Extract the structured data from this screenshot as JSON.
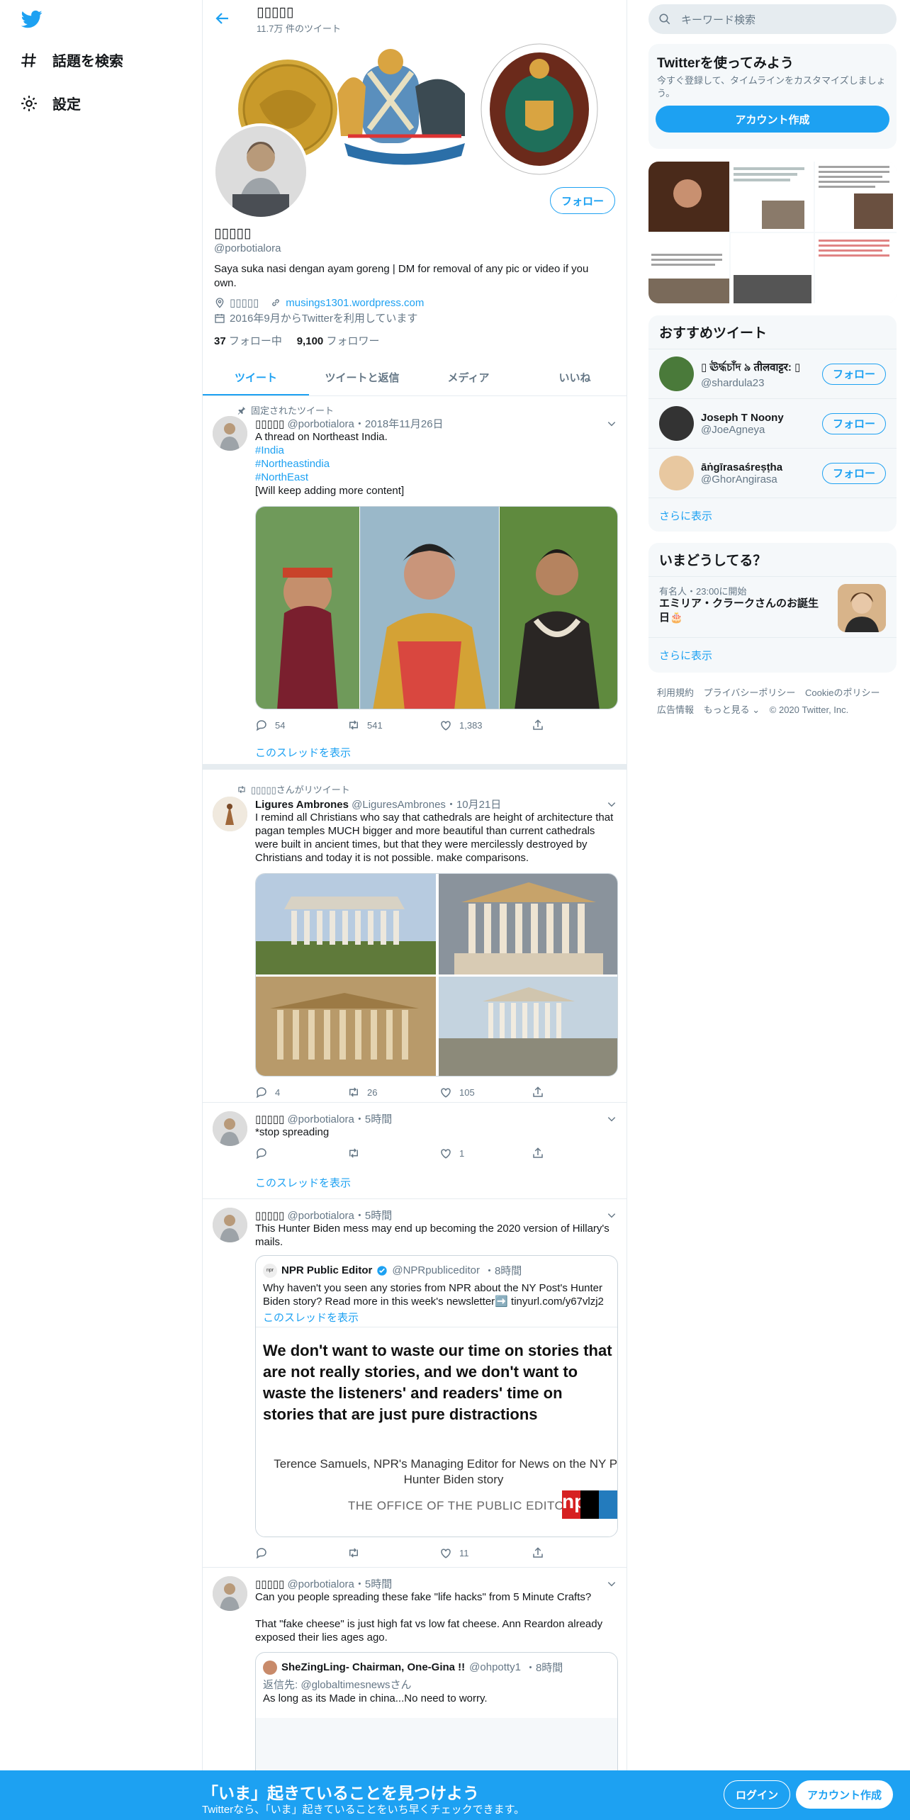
{
  "profile": {
    "display_name": "▯▯▯▯▯",
    "tweet_count": "11.7万 件のツイート",
    "handle": "@porbotialora",
    "bio": "Saya suka nasi dengan ayam goreng | DM for removal of any pic or video if you own.",
    "location": "▯▯▯▯▯",
    "website": "musings1301.wordpress.com",
    "joined": "2016年9月からTwitterを利用しています",
    "following_count": "37",
    "following_label": "フォロー中",
    "followers_count": "9,100",
    "followers_label": "フォロワー",
    "follow_label": "フォロー"
  },
  "nav": {
    "explore_label": "話題を検索",
    "settings_label": "設定"
  },
  "tabs": [
    "ツイート",
    "ツイートと返信",
    "メディア",
    "いいね"
  ],
  "tweets": [
    {
      "context": "固定されたツイート",
      "name": "▯▯▯▯▯",
      "handle": "@porbotialora",
      "time": "・2018年11月26日",
      "text": "A thread on Northeast India.",
      "hashtags": [
        "#India",
        "#Northeastindia",
        "#NorthEast"
      ],
      "extra": "[Will keep adding more content]",
      "replies": "54",
      "retweets": "541",
      "likes": "1,383",
      "thread_label": "このスレッドを表示"
    },
    {
      "context": "▯▯▯▯▯さんがリツイート",
      "name": "Ligures Ambrones",
      "handle": "@LiguresAmbrones",
      "time": "・10月21日",
      "text": "I remind all Christians who say that cathedrals are height of architecture that pagan temples MUCH bigger and more beautiful than current cathedrals were built in ancient times, but that they were mercilessly destroyed by Christians and today it is not possible. make comparisons.",
      "replies": "4",
      "retweets": "26",
      "likes": "105"
    },
    {
      "name": "▯▯▯▯▯",
      "handle": "@porbotialora",
      "time": "・5時間",
      "text": "*stop spreading",
      "replies": "",
      "retweets": "",
      "likes": "1",
      "thread_label": "このスレッドを表示"
    },
    {
      "name": "▯▯▯▯▯",
      "handle": "@porbotialora",
      "time": "・5時間",
      "text": "This Hunter Biden mess may end up becoming the 2020 version of Hillary's mails.",
      "quote": {
        "name": "NPR Public Editor",
        "handle": "@NPRpubliceditor",
        "time": "・8時間",
        "text": "Why haven't you seen any stories from NPR about the NY Post's Hunter Biden story? Read more in this week's newsletter➡️ tinyurl.com/y67vlzj2",
        "thread_label": "このスレッドを表示",
        "card_headline": "We don't want to waste our time on stories that are not really stories, and we don't want to waste the listeners' and readers' time on stories that are just pure distractions",
        "card_attribution": "Terence Samuels, NPR's Managing Editor for News on the NY Post Hunter Biden story",
        "card_office": "THE OFFICE OF THE PUBLIC EDITOR",
        "card_logo": "np"
      },
      "replies": "",
      "retweets": "",
      "likes": "11"
    },
    {
      "name": "▯▯▯▯▯",
      "handle": "@porbotialora",
      "time": "・5時間",
      "text": "Can you people spreading these fake \"life hacks\" from 5 Minute Crafts?",
      "text2": "That \"fake cheese\" is just high fat vs low fat cheese. Ann Reardon already exposed their lies ages ago.",
      "quote": {
        "name": "SheZingLing- Chairman, One-Gina !!",
        "handle": "@ohpotty1",
        "time": "・8時間",
        "reply_to_label": "返信先:",
        "reply_to": "@globaltimesnewsさん",
        "text": "As long as its Made in china...No need to worry."
      }
    }
  ],
  "sidebar": {
    "search_placeholder": "キーワード検索",
    "signup_card": {
      "title": "Twitterを使ってみよう",
      "subtitle": "今すぐ登録して、タイムラインをカスタマイズしましょう。",
      "button": "アカウント作成"
    },
    "recommend": {
      "title": "おすすめツイート",
      "users": [
        {
          "name": "▯ ঊৰ্দ্ধচাঁদ ৯ तीलवाट्टर: ▯",
          "handle": "@shardula23"
        },
        {
          "name": "Joseph T Noony",
          "handle": "@JoeAgneya"
        },
        {
          "name": "āṅgīrasaśreṣṭha",
          "handle": "@GhorAngirasa"
        }
      ],
      "follow_label": "フォロー",
      "more": "さらに表示"
    },
    "trends": {
      "title": "いまどうしてる？",
      "meta": "有名人・23:00に開始",
      "headline": "エミリア・クラークさんのお誕生日🎂",
      "more": "さらに表示"
    },
    "footer": [
      "利用規約",
      "プライバシーポリシー",
      "Cookieのポリシー",
      "広告情報",
      "もっと見る ⌄",
      "© 2020 Twitter, Inc."
    ]
  },
  "bottom_bar": {
    "title": "「いま」起きていることを見つけよう",
    "subtitle": "Twitterなら、「いま」起きていることをいち早くチェックできます。",
    "login": "ログイン",
    "signup": "アカウント作成"
  },
  "colors": {
    "brand": "#1da1f2",
    "text": "#14171a",
    "muted": "#657786",
    "border": "#e6ecf0"
  }
}
